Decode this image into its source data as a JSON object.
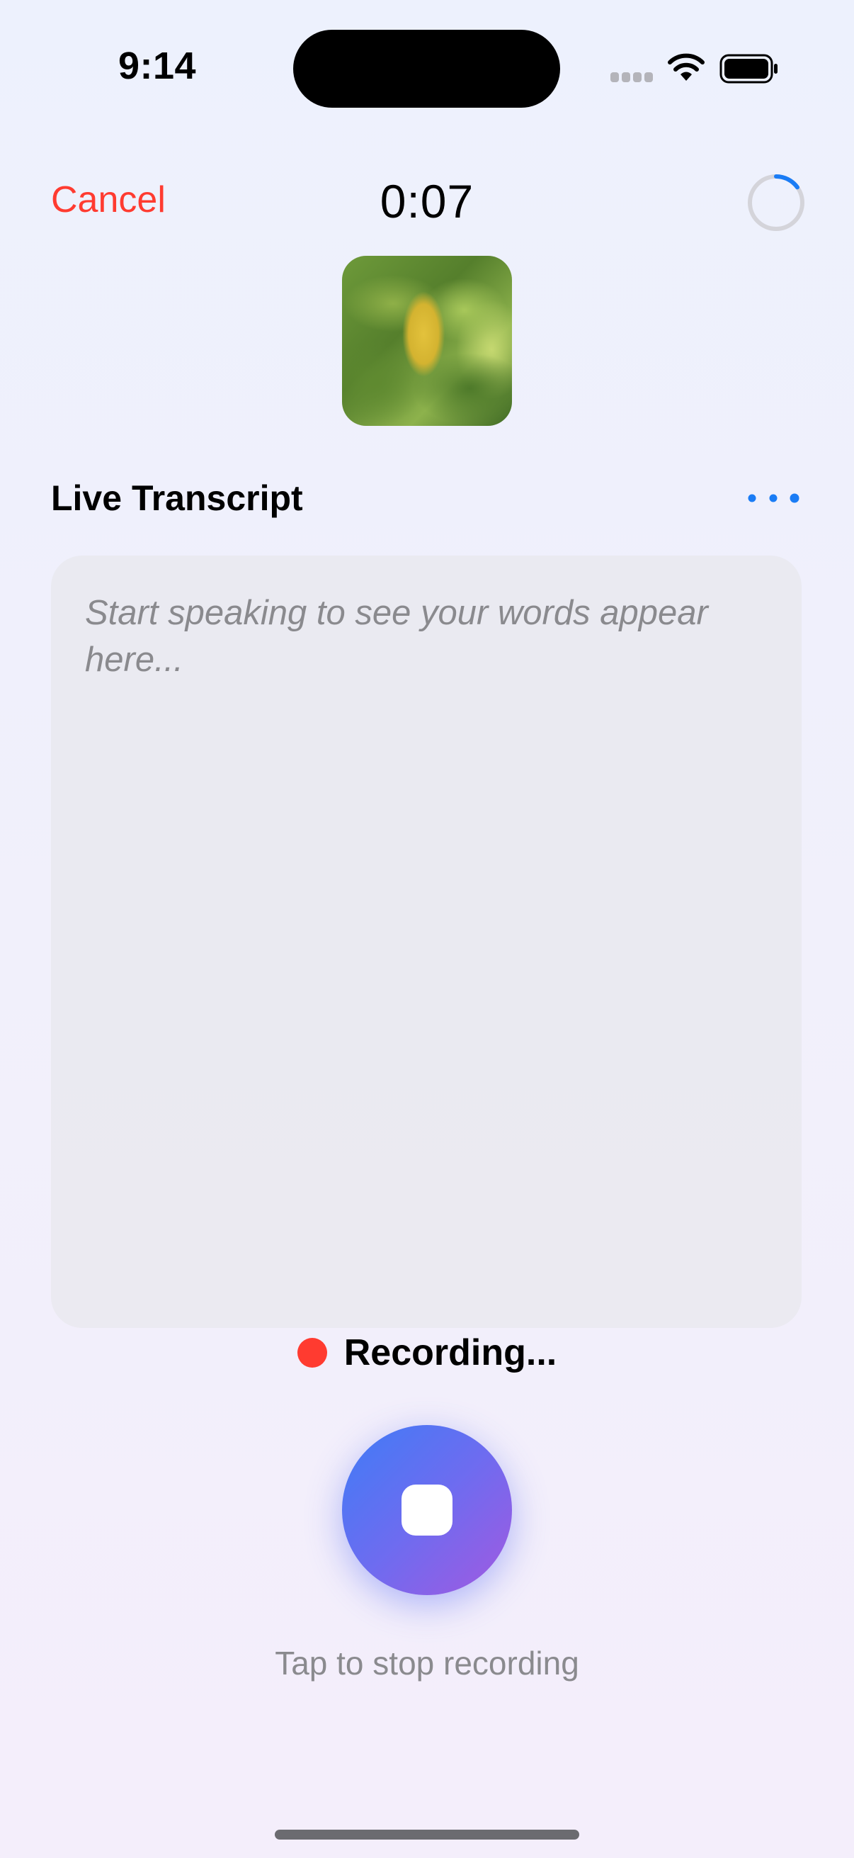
{
  "status_bar": {
    "time": "9:14"
  },
  "header": {
    "cancel_label": "Cancel",
    "timer": "0:07",
    "progress_fraction": 0.15
  },
  "transcript": {
    "title": "Live Transcript",
    "placeholder": "Start speaking to see your words appear here..."
  },
  "recording": {
    "status_label": "Recording...",
    "hint": "Tap to stop recording"
  },
  "icons": {
    "status": [
      "cell-signal-icon",
      "wifi-icon",
      "battery-icon"
    ],
    "header": [
      "progress-ring-icon"
    ],
    "transcript": [
      "ellipsis-icon"
    ],
    "controls": [
      "stop-icon"
    ]
  },
  "colors": {
    "cancel": "#ff3b30",
    "accent": "#1a7cf5",
    "recording_dot": "#ff3b30",
    "gradient_start": "#3f7cf6",
    "gradient_end": "#a259e0"
  }
}
